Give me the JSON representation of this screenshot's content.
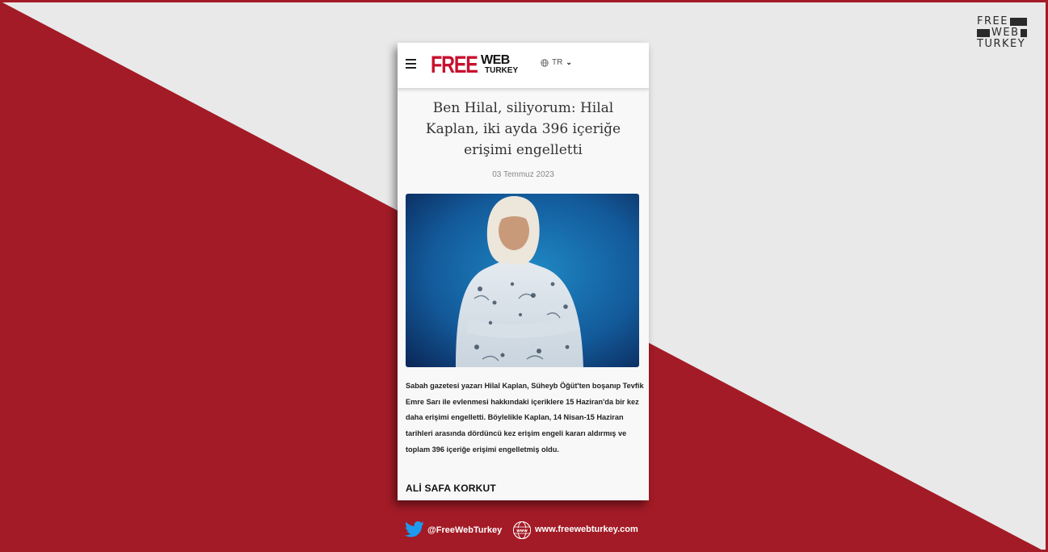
{
  "brand": {
    "line1": "FREE",
    "line2": "WEB",
    "line3": "TURKEY"
  },
  "site": {
    "logo_free": "FREE",
    "logo_web": "WEB",
    "logo_turkey": "TURKEY",
    "language": "TR"
  },
  "article": {
    "title": "Ben Hilal, siliyorum: Hilal Kaplan, iki ayda 396 içeriğe erişimi engelletti",
    "date": "03 Temmuz 2023",
    "body": "Sabah gazetesi yazarı Hilal Kaplan, Süheyb Öğüt'ten boşanıp Tevfik Emre Sarı ile evlenmesi hakkındaki içeriklere 15 Haziran'da bir kez daha erişimi engelletti. Böylelikle Kaplan, 14 Nisan-15 Haziran tarihleri arasında dördüncü kez erişim engeli kararı aldırmış ve toplam 396 içeriğe erişimi engelletmiş oldu.",
    "author": "ALİ SAFA KORKUT"
  },
  "footer": {
    "twitter_handle": "@FreeWebTurkey",
    "website": "www.freewebturkey.com"
  },
  "colors": {
    "brand_red": "#a31b26",
    "light_gray": "#e9e9ea",
    "logo_red": "#c8102e"
  },
  "icons": [
    "hamburger-menu-icon",
    "globe-icon",
    "chevron-down-icon",
    "twitter-bird-icon",
    "www-globe-icon"
  ]
}
